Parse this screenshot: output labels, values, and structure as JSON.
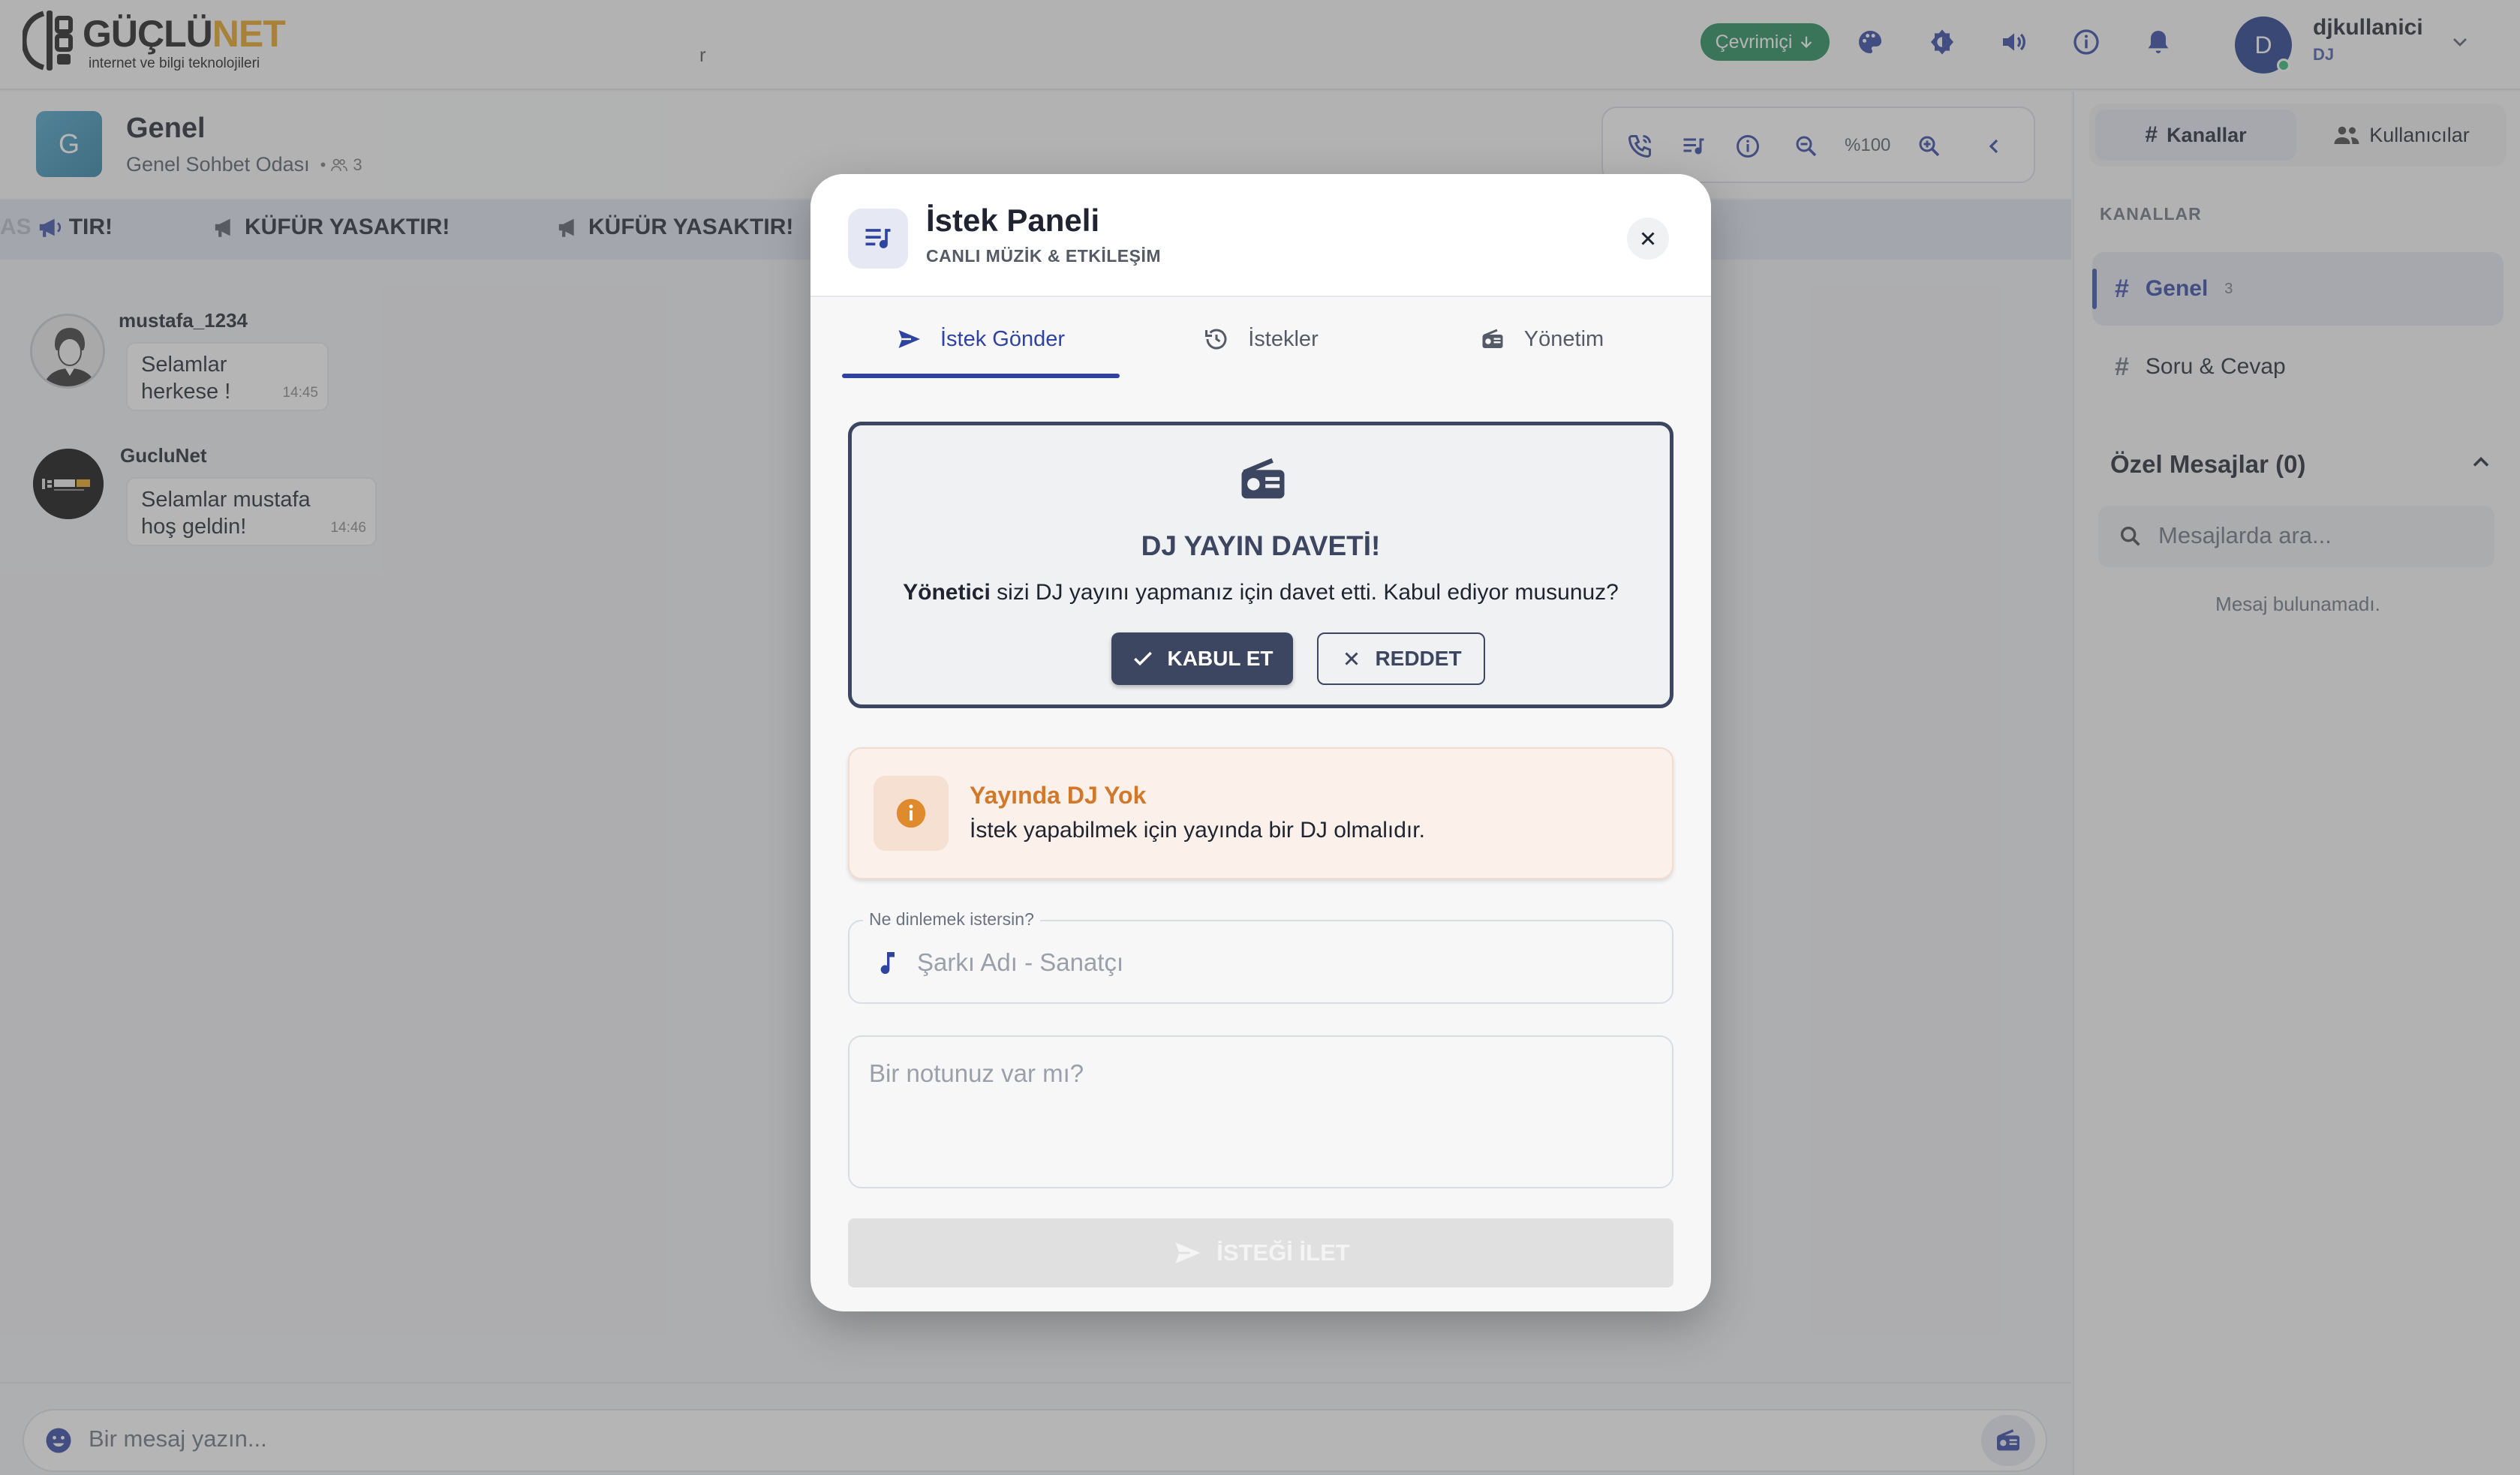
{
  "app": {
    "logo_main": "GÜÇLÜ",
    "logo_accent": "NET",
    "logo_sub": "internet ve bilgi teknolojileri",
    "stray_char": "r"
  },
  "topbar": {
    "status_label": "Çevrimiçi",
    "icons": [
      "palette-icon",
      "brightness-icon",
      "volume-icon",
      "info-icon",
      "bell-icon"
    ],
    "user": {
      "initial": "D",
      "name": "djkullanici",
      "role": "DJ"
    }
  },
  "channel": {
    "avatar_letter": "G",
    "title": "Genel",
    "subtitle": "Genel Sohbet Odası",
    "member_count": "3",
    "zoom": "%100"
  },
  "marquee": {
    "items": [
      "TIR!",
      "KÜFÜR YASAKTIR!",
      "KÜFÜR YASAKTIR!"
    ],
    "fade_prefix": "AS"
  },
  "messages": [
    {
      "user": "mustafa_1234",
      "text_line1": "Selamlar",
      "text_line2": "herkese !",
      "time": "14:45"
    },
    {
      "user": "GucluNet",
      "text_line1": "Selamlar mustafa",
      "text_line2": "hoş geldin!",
      "time": "14:46"
    }
  ],
  "composer": {
    "placeholder": "Bir mesaj yazın..."
  },
  "right_panel": {
    "tab_channels": "Kanallar",
    "tab_users": "Kullanıcılar",
    "section_channels": "KANALLAR",
    "channels": [
      {
        "name": "Genel",
        "count": "3"
      },
      {
        "name": "Soru & Cevap",
        "count": ""
      }
    ],
    "pm_title": "Özel Mesajlar (0)",
    "pm_search_placeholder": "Mesajlarda ara...",
    "pm_empty": "Mesaj bulunamadı."
  },
  "modal": {
    "title": "İstek Paneli",
    "subtitle": "CANLI MÜZİK & ETKİLEŞİM",
    "tabs": [
      "İstek Gönder",
      "İstekler",
      "Yönetim"
    ],
    "active_tab": 0,
    "invite": {
      "title": "DJ YAYIN DAVETİ!",
      "text_bold": "Yönetici",
      "text_rest": " sizi DJ yayını yapmanız için davet etti. Kabul ediyor musunuz?",
      "accept": "KABUL ET",
      "reject": "REDDET"
    },
    "warning": {
      "title": "Yayında DJ Yok",
      "text": "İstek yapabilmek için yayında bir DJ olmalıdır."
    },
    "song_field": {
      "legend": "Ne dinlemek istersin?",
      "placeholder": "Şarkı Adı - Sanatçı"
    },
    "note_field": {
      "placeholder": "Bir notunuz var mı?"
    },
    "send_button": "İSTEĞİ İLET"
  },
  "colors": {
    "primary": "#2f43a0",
    "dark_slate": "#3d4660",
    "online_green": "#1f8a5a",
    "warning_orange": "#d2782a",
    "brand_gold": "#e8a21a"
  }
}
